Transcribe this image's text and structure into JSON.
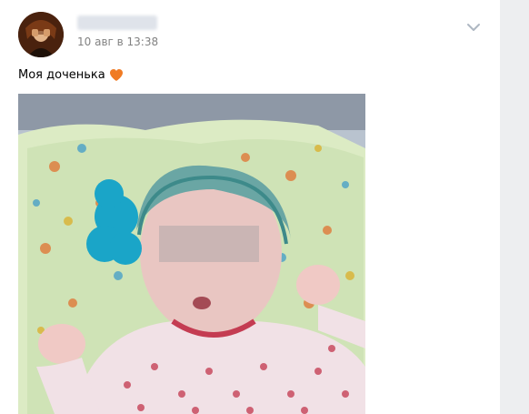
{
  "post": {
    "author_name": "",
    "date": "10 авг в 13:38",
    "text": "Моя доченька",
    "heart_icon": "orange-heart-emoji",
    "menu_icon": "chevron-down-icon",
    "photo_description_icon": "photo-icon"
  },
  "colors": {
    "background": "#edeef0",
    "card": "#ffffff",
    "date_text": "#828282",
    "heart": "#f07b24",
    "chevron": "#aeb7c2"
  }
}
